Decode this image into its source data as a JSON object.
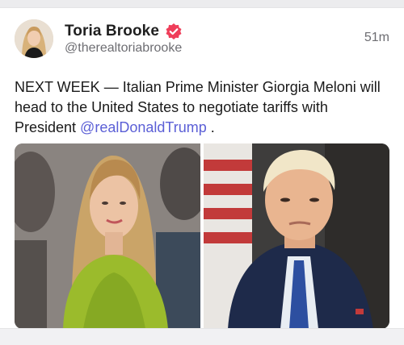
{
  "post": {
    "author_name": "Toria Brooke",
    "author_handle": "@therealtoriabrooke",
    "timestamp": "51m",
    "text_before_mention": "NEXT WEEK — Italian Prime Minister Giorgia Meloni will head to the United States to negotiate tariffs with President ",
    "mention": "@realDonaldTrump",
    "text_after_mention": " .",
    "verified_icon": "verified-badge-icon",
    "verified_color": "#ef3e5a",
    "mention_color": "#5b5fd6"
  },
  "media": {
    "images": [
      {
        "name": "photo-left"
      },
      {
        "name": "photo-right"
      }
    ]
  }
}
